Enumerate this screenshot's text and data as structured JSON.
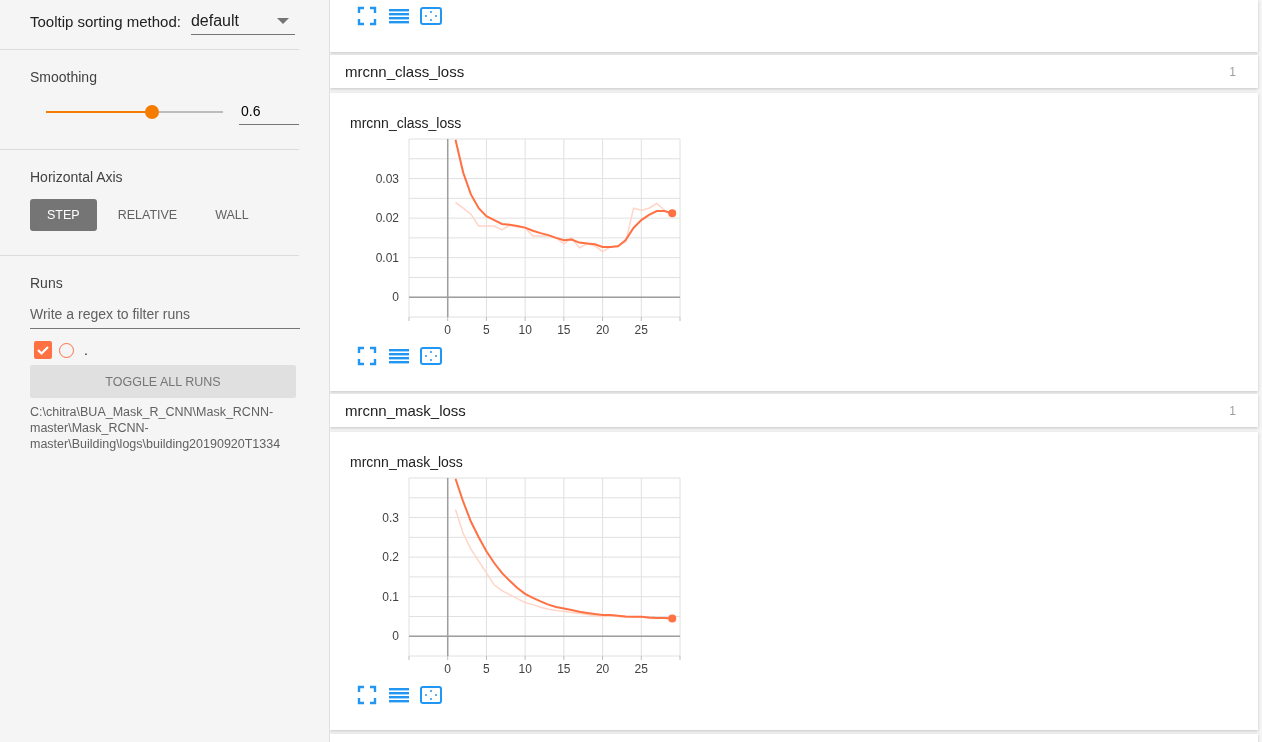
{
  "sidebar": {
    "tooltip_sorting": {
      "label": "Tooltip sorting method:",
      "value": "default"
    },
    "smoothing": {
      "title": "Smoothing",
      "level": 0.6,
      "value": "0.6"
    },
    "horizontal_axis": {
      "title": "Horizontal Axis",
      "options": [
        {
          "label": "STEP",
          "selected": true
        },
        {
          "label": "RELATIVE",
          "selected": false
        },
        {
          "label": "WALL",
          "selected": false
        }
      ]
    },
    "runs": {
      "title": "Runs",
      "placeholder": "Write a regex to filter runs",
      "items": [
        {
          "label": ".",
          "checked": true,
          "selected": false,
          "color": "#ff7043"
        }
      ],
      "toggle_button": "TOGGLE ALL RUNS",
      "logdir": "C:\\chitra\\BUA_Mask_R_CNN\\Mask_RCNN-master\\Mask_RCNN-master\\Building\\logs\\building20190920T1334"
    }
  },
  "sections": [
    {
      "name": "mrcnn_class_loss",
      "count": "1",
      "charts": [
        {
          "title": "mrcnn_class_loss",
          "chart_data": {
            "type": "line",
            "x": [
              1,
              2,
              3,
              4,
              5,
              6,
              7,
              8,
              9,
              10,
              11,
              12,
              13,
              14,
              15,
              16,
              17,
              18,
              19,
              20,
              21,
              22,
              23,
              24,
              25,
              26,
              27,
              28,
              29
            ],
            "grid": true,
            "xlim": [
              -5,
              30
            ],
            "ylim": [
              -0.005,
              0.04
            ],
            "xticks": [
              0,
              5,
              10,
              15,
              20,
              25
            ],
            "yticks": [
              0,
              0.01,
              0.02,
              0.03
            ],
            "series": [
              {
                "color": "#ffd5c8",
                "values": [
                  0.024,
                  0.0225,
                  0.021,
                  0.018,
                  0.018,
                  0.018,
                  0.017,
                  0.0182,
                  0.0178,
                  0.0175,
                  0.0155,
                  0.0155,
                  0.0155,
                  0.015,
                  0.0135,
                  0.015,
                  0.0125,
                  0.0135,
                  0.013,
                  0.0115,
                  0.0127,
                  0.013,
                  0.014,
                  0.0225,
                  0.022,
                  0.0225,
                  0.0237,
                  0.022,
                  0.0205
                ]
              },
              {
                "color": "#ff7043",
                "values": [
                  0.0398,
                  0.0315,
                  0.026,
                  0.0225,
                  0.0205,
                  0.0195,
                  0.0185,
                  0.0183,
                  0.018,
                  0.0176,
                  0.0168,
                  0.0162,
                  0.0157,
                  0.015,
                  0.0144,
                  0.0146,
                  0.0138,
                  0.0136,
                  0.0134,
                  0.0127,
                  0.0127,
                  0.0129,
                  0.0145,
                  0.0175,
                  0.0195,
                  0.0208,
                  0.0218,
                  0.0218,
                  0.0212
                ]
              }
            ]
          }
        }
      ]
    },
    {
      "name": "mrcnn_mask_loss",
      "count": "1",
      "charts": [
        {
          "title": "mrcnn_mask_loss",
          "chart_data": {
            "type": "line",
            "x": [
              1,
              2,
              3,
              4,
              5,
              6,
              7,
              8,
              9,
              10,
              11,
              12,
              13,
              14,
              15,
              16,
              17,
              18,
              19,
              20,
              21,
              22,
              23,
              24,
              25,
              26,
              27,
              28,
              29
            ],
            "grid": true,
            "xlim": [
              -5,
              30
            ],
            "ylim": [
              -0.05,
              0.4
            ],
            "xticks": [
              0,
              5,
              10,
              15,
              20,
              25
            ],
            "yticks": [
              0,
              0.1,
              0.2,
              0.3
            ],
            "series": [
              {
                "color": "#ffd5c8",
                "values": [
                  0.32,
                  0.26,
                  0.22,
                  0.19,
                  0.16,
                  0.13,
                  0.115,
                  0.105,
                  0.095,
                  0.085,
                  0.08,
                  0.073,
                  0.068,
                  0.065,
                  0.063,
                  0.06,
                  0.058,
                  0.055,
                  0.052,
                  0.05,
                  0.052,
                  0.05,
                  0.048,
                  0.048,
                  0.05,
                  0.045,
                  0.045,
                  0.046,
                  0.044
                ]
              },
              {
                "color": "#ff7043",
                "values": [
                  0.398,
                  0.34,
                  0.29,
                  0.25,
                  0.215,
                  0.185,
                  0.16,
                  0.14,
                  0.122,
                  0.107,
                  0.097,
                  0.088,
                  0.08,
                  0.074,
                  0.07,
                  0.066,
                  0.062,
                  0.059,
                  0.056,
                  0.054,
                  0.054,
                  0.052,
                  0.05,
                  0.049,
                  0.049,
                  0.047,
                  0.046,
                  0.046,
                  0.045
                ]
              }
            ]
          }
        }
      ]
    }
  ]
}
